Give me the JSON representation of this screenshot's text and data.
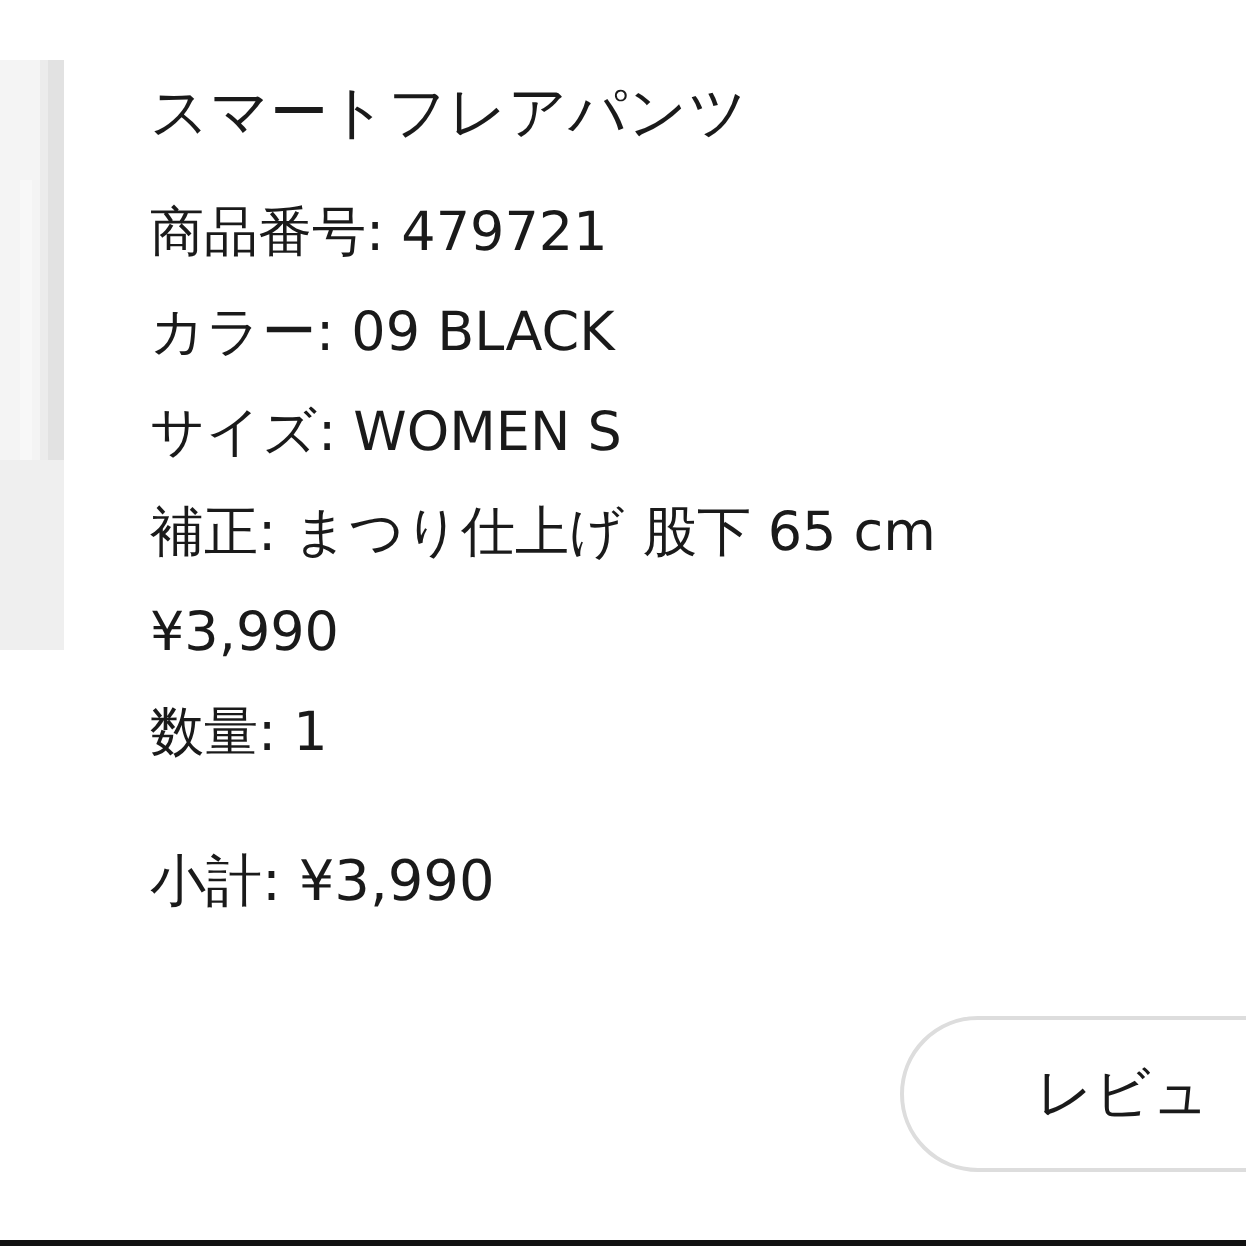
{
  "product": {
    "name": "スマートフレアパンツ",
    "details": [
      "商品番号: 479721",
      "カラー: 09 BLACK",
      "サイズ: WOMEN S",
      "補正: まつり仕上げ 股下 65 cm",
      "¥3,990",
      "数量: 1"
    ],
    "subtotal": "小計: ¥3,990"
  },
  "buttons": [
    {
      "label": "レビュ"
    }
  ]
}
